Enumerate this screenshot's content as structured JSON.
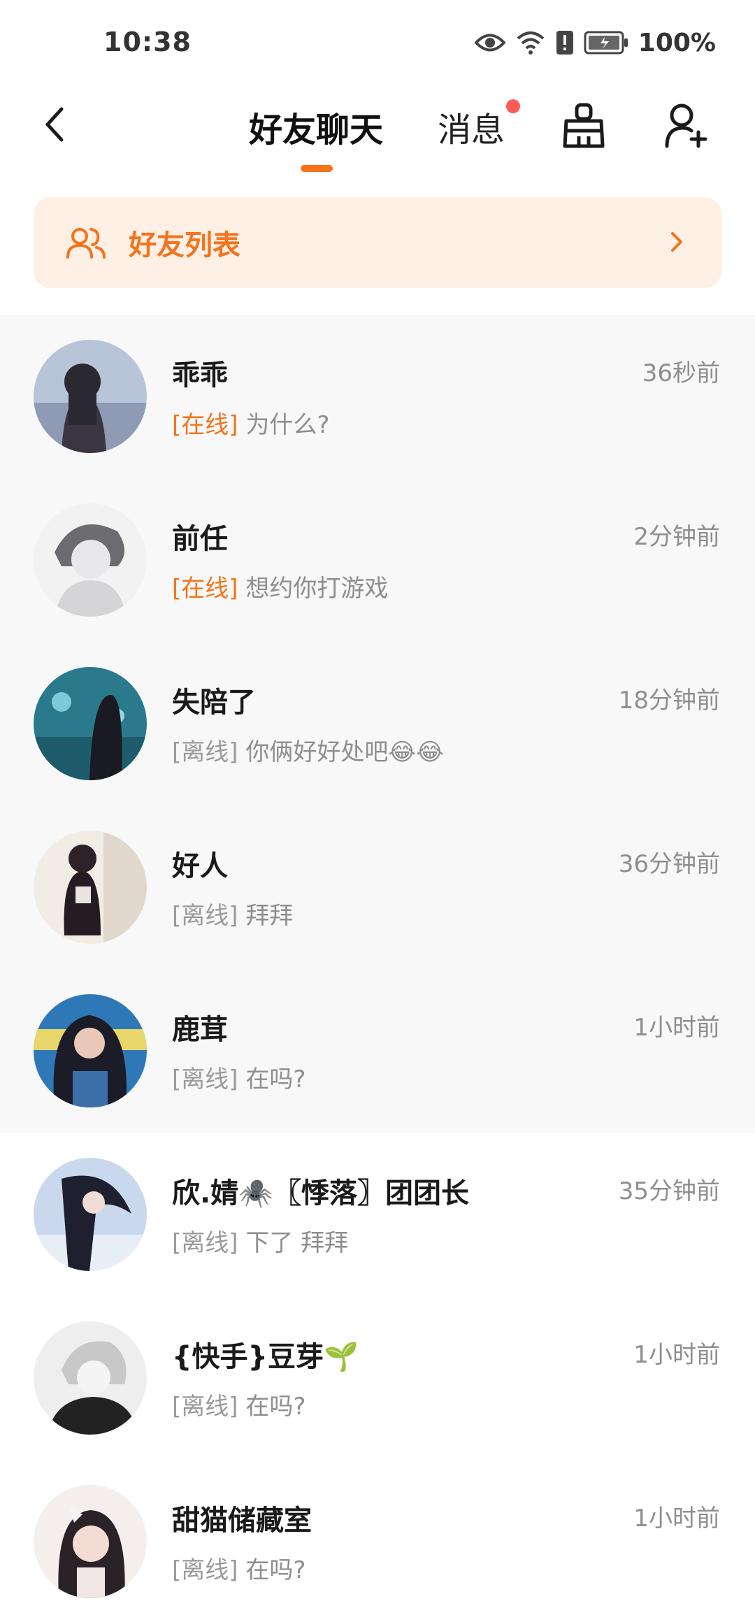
{
  "status_bar": {
    "time": "10:38",
    "battery_percent": "100%",
    "icons": [
      "eye-icon",
      "wifi-icon",
      "alert-sim-icon",
      "battery-icon"
    ]
  },
  "header": {
    "back_icon": "chevron-left-icon",
    "tabs": [
      {
        "label": "好友聊天",
        "active": true
      },
      {
        "label": "消息",
        "has_badge_dot": true
      }
    ],
    "clean_icon": "broom-icon",
    "add_friend_icon": "add-user-icon"
  },
  "friend_list_banner": {
    "icon": "friends-icon",
    "label": "好友列表",
    "chevron_icon": "chevron-right-icon"
  },
  "colors": {
    "accent": "#f5731a",
    "banner_bg": "#fff0e6",
    "badge_dot": "#ff5b57",
    "text_secondary": "#8e8e8e"
  },
  "chats": [
    {
      "name": "乖乖",
      "time": "36秒前",
      "status": "[在线]",
      "online": true,
      "message": "为什么?"
    },
    {
      "name": "前任",
      "time": "2分钟前",
      "status": "[在线]",
      "online": true,
      "message": "想约你打游戏"
    },
    {
      "name": "失陪了",
      "time": "18分钟前",
      "status": "[离线]",
      "online": false,
      "message": "你俩好好处吧😂😂"
    },
    {
      "name": "好人",
      "time": "36分钟前",
      "status": "[离线]",
      "online": false,
      "message": "拜拜"
    },
    {
      "name": "鹿茸",
      "time": "1小时前",
      "status": "[离线]",
      "online": false,
      "message": "在吗?"
    },
    {
      "name": "欣.婧🕷️〖悸落〗团团长",
      "time": "35分钟前",
      "status": "[离线]",
      "online": false,
      "message": "下了  拜拜"
    },
    {
      "name": "{快手}豆芽🌱",
      "time": "1小时前",
      "status": "[离线]",
      "online": false,
      "message": "在吗?"
    },
    {
      "name": "甜猫储藏室",
      "time": "1小时前",
      "status": "[离线]",
      "online": false,
      "message": "在吗?"
    }
  ]
}
